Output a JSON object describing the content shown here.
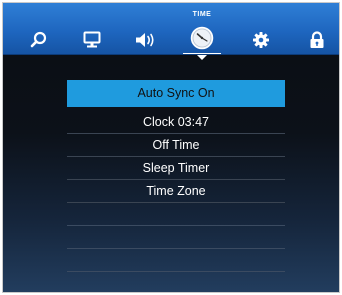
{
  "menu": {
    "tabs": [
      {
        "id": "search",
        "icon": "search-icon",
        "label": ""
      },
      {
        "id": "display",
        "icon": "monitor-icon",
        "label": ""
      },
      {
        "id": "sound",
        "icon": "speaker-icon",
        "label": ""
      },
      {
        "id": "time",
        "icon": "clock-icon",
        "label": "TIME",
        "active": true
      },
      {
        "id": "settings",
        "icon": "gear-icon",
        "label": ""
      },
      {
        "id": "lock",
        "icon": "lock-icon",
        "label": ""
      }
    ]
  },
  "time_menu": {
    "items": [
      {
        "label": "Auto Sync On",
        "selected": true
      },
      {
        "label": "Clock 03:47"
      },
      {
        "label": "Off Time"
      },
      {
        "label": "Sleep Timer"
      },
      {
        "label": "Time Zone"
      }
    ],
    "empty_rows": 4
  },
  "colors": {
    "menubar": "#1e66bf",
    "selected_item": "#1f9bde",
    "text": "#ffffff",
    "background_dark": "#0c1119"
  }
}
